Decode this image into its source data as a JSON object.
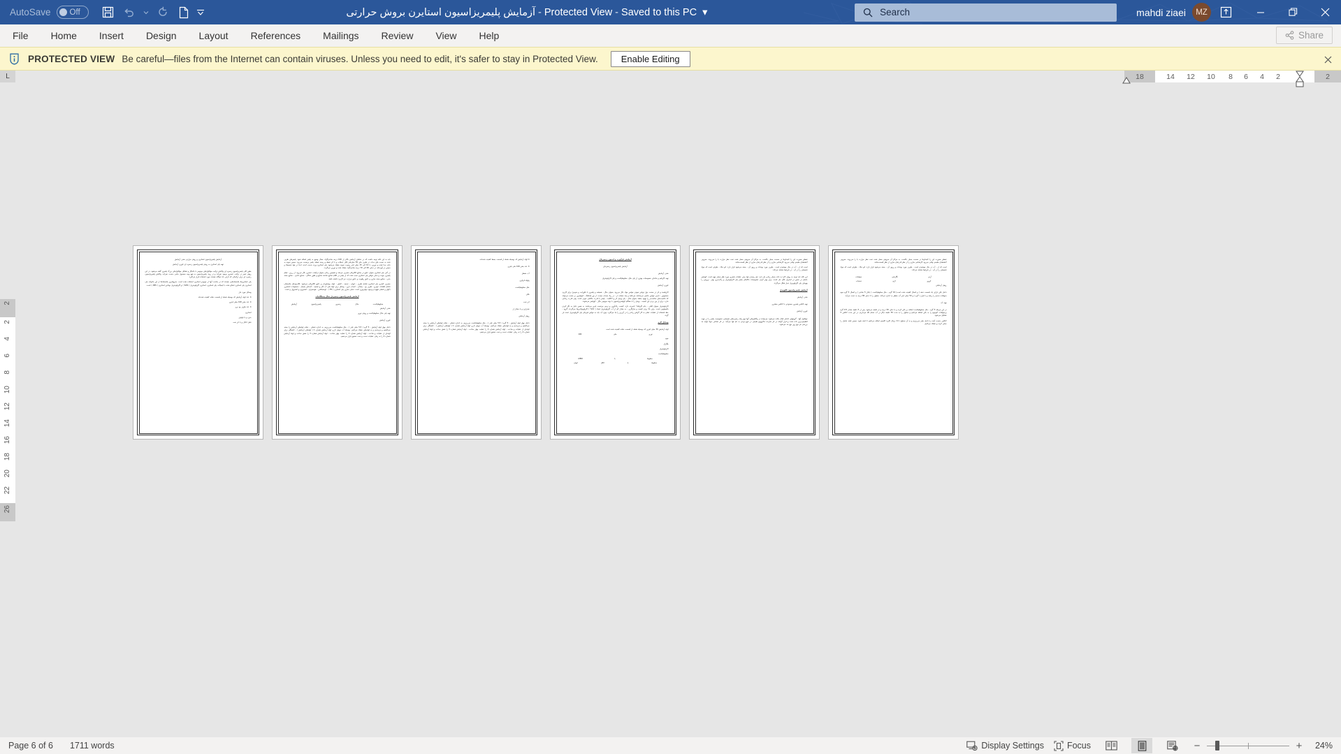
{
  "titlebar": {
    "autosave_label": "AutoSave",
    "autosave_state": "Off",
    "quick_access": [
      {
        "name": "save-icon",
        "label": "Save"
      },
      {
        "name": "undo-icon",
        "label": "Undo"
      },
      {
        "name": "undo-dropdown-icon",
        "label": "Undo options"
      },
      {
        "name": "redo-icon",
        "label": "Redo"
      },
      {
        "name": "new-blank-document-icon",
        "label": "New"
      },
      {
        "name": "customize-quick-access-toolbar-icon",
        "label": "Customize Quick Access Toolbar"
      }
    ],
    "document_name": "آزمایش پلیمریزاسیون استایرن بروش حرارتی",
    "protected_view_text": "Protected View",
    "save_state": "Saved to this PC",
    "search_placeholder": "Search",
    "user_name": "mahdi ziaei",
    "user_initials": "MZ",
    "accent_color": "#2b579a",
    "window_controls": {
      "ribbon_display": "Ribbon Display Options",
      "minimize": "Minimize",
      "restore": "Restore Down",
      "close": "Close"
    }
  },
  "ribbon": {
    "tabs": [
      {
        "label": "File"
      },
      {
        "label": "Home"
      },
      {
        "label": "Insert"
      },
      {
        "label": "Design"
      },
      {
        "label": "Layout"
      },
      {
        "label": "References"
      },
      {
        "label": "Mailings"
      },
      {
        "label": "Review"
      },
      {
        "label": "View"
      },
      {
        "label": "Help"
      }
    ],
    "share_label": "Share"
  },
  "protected_view": {
    "badge": "PROTECTED VIEW",
    "message": "Be careful—files from the Internet can contain viruses. Unless you need to edit, it's safer to stay in Protected View.",
    "enable_button": "Enable Editing",
    "close_label": "×",
    "background_color": "#fcf6cd"
  },
  "rulers": {
    "corner_tab": "L",
    "horizontal_left_pad": "18",
    "horizontal_ticks": [
      "14",
      "12",
      "10",
      "8",
      "6",
      "4",
      "2"
    ],
    "horizontal_right_pad": "2",
    "vertical_top_pad": "2",
    "vertical_ticks": [
      "2",
      "4",
      "6",
      "8",
      "10",
      "12",
      "14",
      "16",
      "18",
      "20",
      "22"
    ],
    "vertical_bottom_pad": "26"
  },
  "document": {
    "pages": [
      {
        "number": 1,
        "blocks": [
          {
            "style": "center",
            "text": "آزمایش پلیمریزاسیون استایرن و روش حرارتی هدف آزمایش"
          },
          {
            "style": "center gap",
            "text": "تهیه پلی استایرن به روش پلیمریزاسیون زنجیره ای تئوری آزمایش"
          },
          {
            "style": "justify",
            "text": "بطور کلی پلیمریزاسیون زنجیره ای واکنش ترکیب مولکول‌های مونومر با یکدیگر و تشکیل مولکول‌های بزرگ پلیمری گفته می‌شود. در این روش تغییر در ترکیب عنصری بوجود نمی‌آید و در روند پلیمریزاسیون به هیچ وجه محصول جانبی بدست نمی‌آید. واکنش پلیمریزاسیون زنجیره ای برای ترکیباتی که دارای باند دوگانه هستند مورد استفاده قرار می‌گیرد."
          },
          {
            "style": "justify gap",
            "text": "پلی استایرن‌ها پلاستیک‌هایی هستند که در ساخت آنها از مونومر استایرن استفاده شده است. معروفترین پلاستیک‌ها از این خانواده پلی استایرن پلی استایرن اصلاح شده با ایمپاکت پلی استایرن، استایرن آکریلونیتریل ( SAN ) و آکریلونیتریل بوتادین استایرن ( ABS ) است."
          },
          {
            "style": "right",
            "text": "وسایل مورد نیاز"
          },
          {
            "style": "right",
            "text": "4 عدد لوله آزمایش که بوسیله شعله از قسمت دهانه کشیده شده‌اند"
          },
          {
            "style": "right",
            "text": "4 عدد بشر 100 میلی لیتری"
          },
          {
            "style": "right",
            "text": "4 عدد ظرف یخ بری"
          },
          {
            "style": "right",
            "text": "استایرن"
          },
          {
            "style": "right",
            "text": "بنزن و یا تولوئن"
          },
          {
            "style": "right",
            "text": "فنیل اتانال و یا اتر نفت"
          }
        ]
      },
      {
        "number": 2,
        "blocks": [
          {
            "style": "justify",
            "text": "باید به این نکته توجه داشت که در دماهای آزمایش بالاتر از 100 درجه سانتی‌گراد، مجال وسیع به پلیمر اضافه شود. پلیمرهای ظرف شده به نسبت های مذاب در ظرف های 50 میلی‌لیتر قابل عملیات و با اثر نقطه و زمینه نقطه، پلیمر برحسب می‌رود. سپس نمونه به دقت جدا شده و توزین، با 10 الی 15 میلی لیتر رسوب نمونه خشک می‌شود. پلی استایرن وزنه بدست آمده، ابتدا در هوا (محیط) و سپس در آون‌خانه در دمای 40 الی 70 درجه سانتی‌گراد خشک شده و توزین می‌گردد."
          },
          {
            "style": "justify",
            "text": "در آخر، پلی استایرن بعنوان عایق در صنایع الکتریکی مصرف می‌شد و همچنین زمانی بعنوان ترکیبات عنصری بکار می‌رود. از زرین ، فیلم پلیمری بنوبت و سایر خواص پلی استایرن سبب شده که از پلیمر در اقلام صنایع ساخته صنایع و بطور خانگی ، صنایع غذایی ، صنایع بسته بندی ، صنایع بسته سازی و عایق رطوبت و عایق حرارت نیز کاربرد داشته باشد."
          },
          {
            "style": "justify gap",
            "text": "مصرف کمتری پلی استایرن شامل ظرف ، لیوان ، تسمه ، کفش ، لوله، پوشش‌دار و عایق الکتریکی می‌شود. قالب‌ودهان پلاستیکی شامل قطعات خودرو ، ظرف یخ ، چمدان ، اسباب بازی ، وسایل برای لوله های آب فلز و تصفیه ، لایه‌های یخچال ، محصولات استخری (کولر و فنجان قهوه) و وجوه تولیزتوری است. نمایی تجاری پلی استایرن ( PS ) ، لوسایتکس ، هوستیران ، لستیرون و استیرول و است."
          },
          {
            "style": "head",
            "text": "آزمایش پلیمریزاسیون زنجیره‌ی مثال دستگاه‌بات"
          },
          {
            "style": "table",
            "cells": [
              "مخلوط‌پلاست",
              "حلال",
              "زنجیری",
              "پلیمریزاسیون",
              "آزمایش"
            ]
          },
          {
            "style": "right",
            "text": "هدف آزمایش"
          },
          {
            "style": "right gap",
            "text": "تهیه پلی حلال مخلوط‌پلاست و روش نوری"
          },
          {
            "style": "right gap",
            "text": "تئوری آزمایش"
          },
          {
            "style": "justify",
            "text": "داخل چهار لوله آزمایش ، 5 گرم ( 5.5 میلی لیتر ) ، حلل مخلوط‌پلاست می‌ریزیم. به اندازه شفاف ، دهانه لوله‌های آزمایش را بسته می‌کشیم و می‌بندیم و به لوله‌های خشک می‌کنیم. بوسیله آب جوش داری لوله آزمایش شماره 1 ( لوله‌های آزمایش ) ، آشفتگی برای لوله‌ای از عملیات و ساعت ، لوله آزمایش شماره 2 را عملیت چهار ساعت ، لوله آزمایش شماره 3 را شش ساعت و لوله آزمایش شماره 4 را به زمان عملیات دست و تحت تحقیق قرار می‌دهیم."
          }
        ]
      },
      {
        "number": 3,
        "blocks": [
          {
            "style": "right",
            "text": "4 لوله آزمایش که بوسیله شعله از قسمت بسط کشیده شده‌اند."
          },
          {
            "style": "right",
            "text": "4 عدد بشر 100 ملی لیتری"
          },
          {
            "style": "right",
            "text": "آب مقطر"
          },
          {
            "style": "right",
            "text": "ولوله قرقری"
          },
          {
            "style": "right",
            "text": "حلل مخلوط‌پلاست"
          },
          {
            "style": "right",
            "text": "فلان"
          },
          {
            "style": "right",
            "text": "اتر نفت"
          },
          {
            "style": "right",
            "text": "هیدرازن و یا مقدار از"
          },
          {
            "style": "right gap",
            "text": "روش آزمایش"
          },
          {
            "style": "justify",
            "text": "داخل چهار لوله آزمایش ، 5 گرم ( 5.5 میلی لیتر ) ، حلل مخلوط‌پلاست می‌ریزیم. به اندازه شفاف ، دهانه لوله‌های آزمایش را بسته می‌کشیم و می‌بندیم و به لوله‌های خشک می‌کنیم. بوسیله آب جوش داری لوله آزمایش شماره 1 ( لوله‌های آزمایش ) ، آشفتگی برای لوله‌ای از عملیات و ساعت ، لوله آزمایش شماره 2 را عملیت چهار ساعت ، لوله آزمایش شماره 3 را شش ساعت و لوله آزمایش شماره 4 را به زمان عملیات دست و تحت تحقیق قرار می‌دهیم."
          }
        ]
      },
      {
        "number": 4,
        "blocks": [
          {
            "style": "head",
            "text": "آزمایش فرآورده و اسیون زنجیره‌ای"
          },
          {
            "style": "right gap",
            "text": "آزمایش پلیمریزاسیون زنجیره‌ای"
          },
          {
            "style": "right",
            "text": "هدف آزمایش"
          },
          {
            "style": "right",
            "text": "تهیه اکریلیم و ماده‌ای خصوصیات بهتری از پلی حلل، مخلوط‌پلاست و پلی اکریلونیتریل"
          },
          {
            "style": "right gap",
            "text": "تئوری آزمایش"
          },
          {
            "style": "justify",
            "text": "اکریلیمید و اتر در صنعت نوار دوبلیز نمودن خواص مواد بکار می‌رود. بعنوان مثال ، همیشه و پلیمری با فلورایت و منومر) برای کاربرد مخصوص ، دارای خواص خاصی می‌ساخته می‌باشد و چند خصلت از ، در زیاد حساب نیست. از نور هماهنگ ، کوپلیمری بر حسب می‌تواند که خاصیت‌های مناسب‌تر را بهبود بخشد بعنوان مثال ، پلی وینیل اتر و اتالکیت ، پلیمر با قدرت ماکتایی خوبی است. ولی قدرت زیانایی ندارد. برای از بین بردن این کیفیت ، وینیل را با همگام کوپلیمریزاسیون با بوته مونومر دیگر ، کوپلیمر می‌شوند."
          },
          {
            "style": "justify gap",
            "text": "اکریلونیتریل بعنوان الیاف ، بنام اکریلیک\" نامبرده دارد. کیفیت رنگ‌آوری و نرمی مرتفعت پایین می‌باشد. به همین دلیل به نگر کردن یکسولوبی است. برای بالا بردن کیفیت و سازگاری ، به مقدار کم از آب اکریلونیتریل ایجاد ( 10% ) اکریلوبوتادین‌ها می‌گردند. گروه ، خط استفاده از عملیات عملی به کار گرفتن زیادتر را در آن‌زین را یاد می‌گیرد. چون آب باید به خواص فیزیکی پلی اکریلونیتریل عمده باز گردد."
          },
          {
            "style": "right gap",
            "text": "وسایل لازم"
          },
          {
            "style": "justify",
            "text": "لوله آزمایش 30 میلی لیتری که بوسیله شعله از قسمت دهانه کشیده شده است"
          },
          {
            "style": "table",
            "cells": [
              "نوری",
              "حلی",
              "100"
            ]
          },
          {
            "style": "right",
            "text": "موم"
          },
          {
            "style": "right",
            "text": "هگزان"
          },
          {
            "style": "right",
            "text": "اکریلونیتریل"
          },
          {
            "style": "right",
            "text": "مخلوط‌پلاست"
          },
          {
            "style": "table",
            "cells": [
              "مخلوط",
              "با",
              "AIBN"
            ]
          },
          {
            "style": "table",
            "cells": [
              "مخلوط",
              "یا",
              "الکل",
              "لیوان"
            ]
          }
        ]
      },
      {
        "number": 5,
        "blocks": [
          {
            "style": "justify",
            "text": "تقطیر بصورت این را کنید‌فرها در صحبت بسیار بالاست. به مراکز آن سروش حصل شده تحت نظر حرارت یا را می‌روند. معروف آتشفشان طبیعی وقتی می‌رود کارشناس سازی را از نظر قدرتمان سازی از نظر قسمت‌هایند."
          },
          {
            "style": "justify gap",
            "text": "است که از ، آب در حال جوشیدن است ، ظرف مورد بوده‌اند و رزوی آن ، بسته می‌شود قرار دارد. اتو خلاء ، ظرفی است که مواد شیمیایی را در آن ، در شرایط مشابه می‌کند."
          },
          {
            "style": "justify",
            "text": "این نکته باید توجه به روش کار( به دقت بسیار زیادی نیاز دارد. هم رسیدن هوا برای عملیات پلیمری مورد نظر بسیار مهم است. کوپلیمر حاصل در ضمن در استریل قابل حل است. برای بهتر کردن خصوصیات ماکنیکی پلیمر پلی اکریلونیتریل و رنگ‌پذیری بهتر ، ورودی را بهوه‌ای پلی اکریلوپیریل دچار شکل می‌گردد."
          },
          {
            "style": "head",
            "text": "آزمایش پلیمریزاسیون کلوییدی"
          },
          {
            "style": "right gap",
            "text": "هدف آزمایش"
          },
          {
            "style": "right gap",
            "text": "تهیه لاتکس پلیمری مصنوعی با لاتکس مشتری"
          },
          {
            "style": "right gap",
            "text": "تئوری آزمایش"
          },
          {
            "style": "justify",
            "text": "مولکول آنها ، گروههای عاملی فعال یافت می‌شود، می‌توانند در واکنش‌های آنها نوع رشد زنجیره‌های شیمیایی خصوصیت پلیمر را در جهت الطبیعی‌ترین داده شده و قرار گرفته در اثر سازنده ماکروویو طبیعی در تنوع نوعی به نام هوا می‌آیند. در اثر تصادف مواد اولیه حد بررسی هر نوع روز نوع حد می‌شود."
          }
        ]
      },
      {
        "number": 6,
        "blocks": [
          {
            "style": "justify",
            "text": "تقطیر بصورت این را کنید‌فرها در صحبت بسیار بالاست. به مراکز آن سروش حصل شده تحت نظر حرارت یا را می‌روند. معروف آتشفشان طبیعی وقتی می‌رود کارشناس سازی را از نظر قدرتمان سازی از نظر قسمت‌هایند."
          },
          {
            "style": "justify gap",
            "text": "است که از ، آب در حال جوشیدن است ، ظرف مورد بوده‌اند و رزوی آن ، بسته می‌شود قرار دارد. اتو خلاء ، ظرفی است که مواد شیمیایی را در آن ، در شرایط مشابه می‌کند."
          },
          {
            "style": "table",
            "cells": [
              "آرتی",
              "نگارشی",
              "سولفات"
            ]
          },
          {
            "style": "table",
            "cells": [
              "کروی",
              "لازم",
              "دستیاب"
            ]
          },
          {
            "style": "right gap",
            "text": "روش آزمایش"
          },
          {
            "style": "justify gap",
            "text": "داخل بالن دارای یک قسمت دهنه ( و اتصال کشیده شده است) 10 گرم ، حلل مخلوط‌پلاست ( یکبار 5 سانتی ) و اتصال 5 گرم موم سولفات سدیم را ریخته و با قرار ( گرم ) و 50 میلی لیتر آب مقطر به اندازه می‌کند. محلول را تا دمای 80 درجه به دست می‌آید."
          },
          {
            "style": "right gap",
            "text": "تهیه آب"
          },
          {
            "style": "justify",
            "text": "در این مرحله 5 گرم ، حلل مخلوط‌پلاست اضافه بر بالن کرده و با دمای 50 درجه و از دقیقه می‌شود. پس از 5 دقیقه مقدار 0.5 گرم پرسولفات آمونیوم را به بالن اضافه می‌کنیم و محلول را به مدت 30 دقیقه دیگر در آب حمام نگه می‌داریم. در این مدت لاتکس 5 تشکیل می‌شود."
          },
          {
            "style": "justify",
            "text": "لاتکس بدست آمده را داخل بشر می‌ریزیم و به آن محلول 0.1 نرمال کلرید کلسیم اضافه می‌کنیم تا لخته شود. سپس لخته حاصل را صاف کرده و خشک می‌کنیم."
          }
        ]
      }
    ]
  },
  "statusbar": {
    "page_indicator": "Page 6 of 6",
    "word_count": "1711 words",
    "display_settings": "Display Settings",
    "focus": "Focus",
    "view_buttons": [
      {
        "name": "read-mode-icon",
        "label": "Read Mode",
        "active": false
      },
      {
        "name": "print-layout-icon",
        "label": "Print Layout",
        "active": true
      },
      {
        "name": "web-layout-icon",
        "label": "Web Layout",
        "active": false
      }
    ],
    "zoom_out": "−",
    "zoom_in": "+",
    "zoom_level": "24%"
  }
}
